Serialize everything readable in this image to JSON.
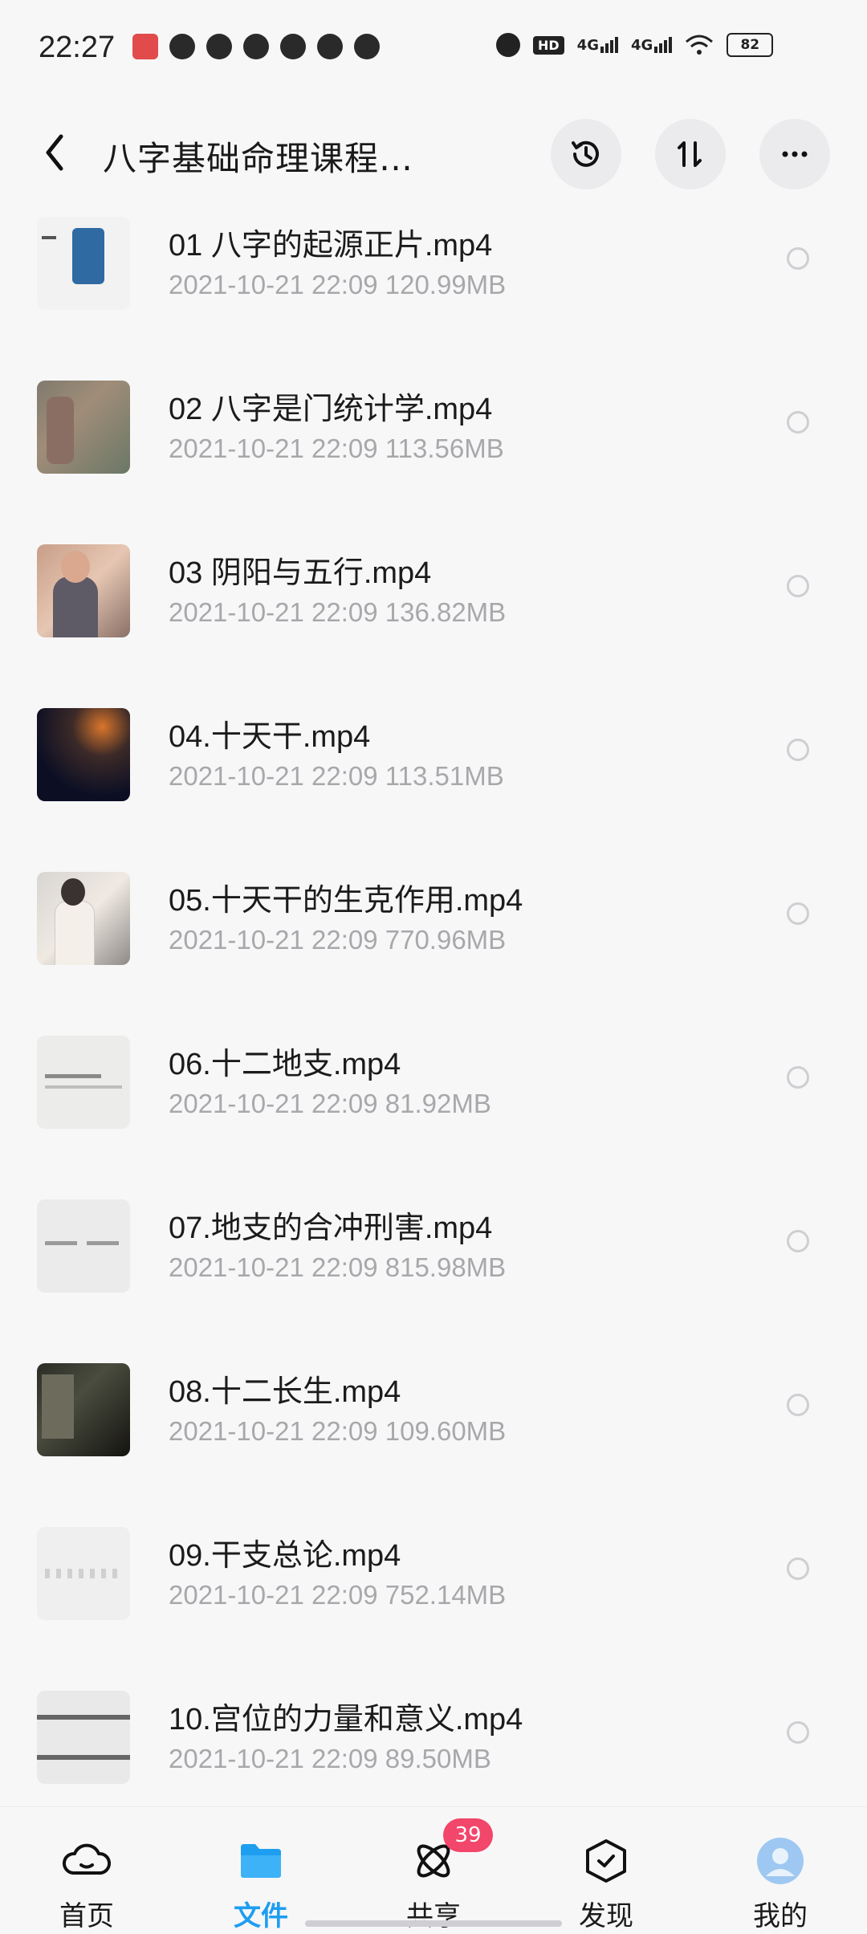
{
  "status_bar": {
    "time": "22:27",
    "net1": "4G",
    "net2": "4G",
    "hd": "HD",
    "battery": "82"
  },
  "header": {
    "title": "八字基础命理课程…"
  },
  "files": [
    {
      "name": "01 八字的起源正片.mp4",
      "date": "2021-10-21",
      "time": "22:09",
      "size": "120.99MB"
    },
    {
      "name": "02 八字是门统计学.mp4",
      "date": "2021-10-21",
      "time": "22:09",
      "size": "113.56MB"
    },
    {
      "name": "03 阴阳与五行.mp4",
      "date": "2021-10-21",
      "time": "22:09",
      "size": "136.82MB"
    },
    {
      "name": "04.十天干.mp4",
      "date": "2021-10-21",
      "time": "22:09",
      "size": "113.51MB"
    },
    {
      "name": "05.十天干的生克作用.mp4",
      "date": "2021-10-21",
      "time": "22:09",
      "size": "770.96MB"
    },
    {
      "name": "06.十二地支.mp4",
      "date": "2021-10-21",
      "time": "22:09",
      "size": "81.92MB"
    },
    {
      "name": "07.地支的合冲刑害.mp4",
      "date": "2021-10-21",
      "time": "22:09",
      "size": "815.98MB"
    },
    {
      "name": "08.十二长生.mp4",
      "date": "2021-10-21",
      "time": "22:09",
      "size": "109.60MB"
    },
    {
      "name": "09.干支总论.mp4",
      "date": "2021-10-21",
      "time": "22:09",
      "size": "752.14MB"
    },
    {
      "name": "10.宫位的力量和意义.mp4",
      "date": "2021-10-21",
      "time": "22:09",
      "size": "89.50MB"
    }
  ],
  "bottom_nav": {
    "items": [
      {
        "label": "首页",
        "icon": "cloud-home-icon"
      },
      {
        "label": "文件",
        "icon": "folder-icon"
      },
      {
        "label": "共享",
        "icon": "share-atom-icon",
        "badge": "39"
      },
      {
        "label": "发现",
        "icon": "discover-box-icon"
      },
      {
        "label": "我的",
        "icon": "avatar-icon"
      }
    ],
    "active_color": "#1e9ef0",
    "badge_color": "#f2466a"
  }
}
